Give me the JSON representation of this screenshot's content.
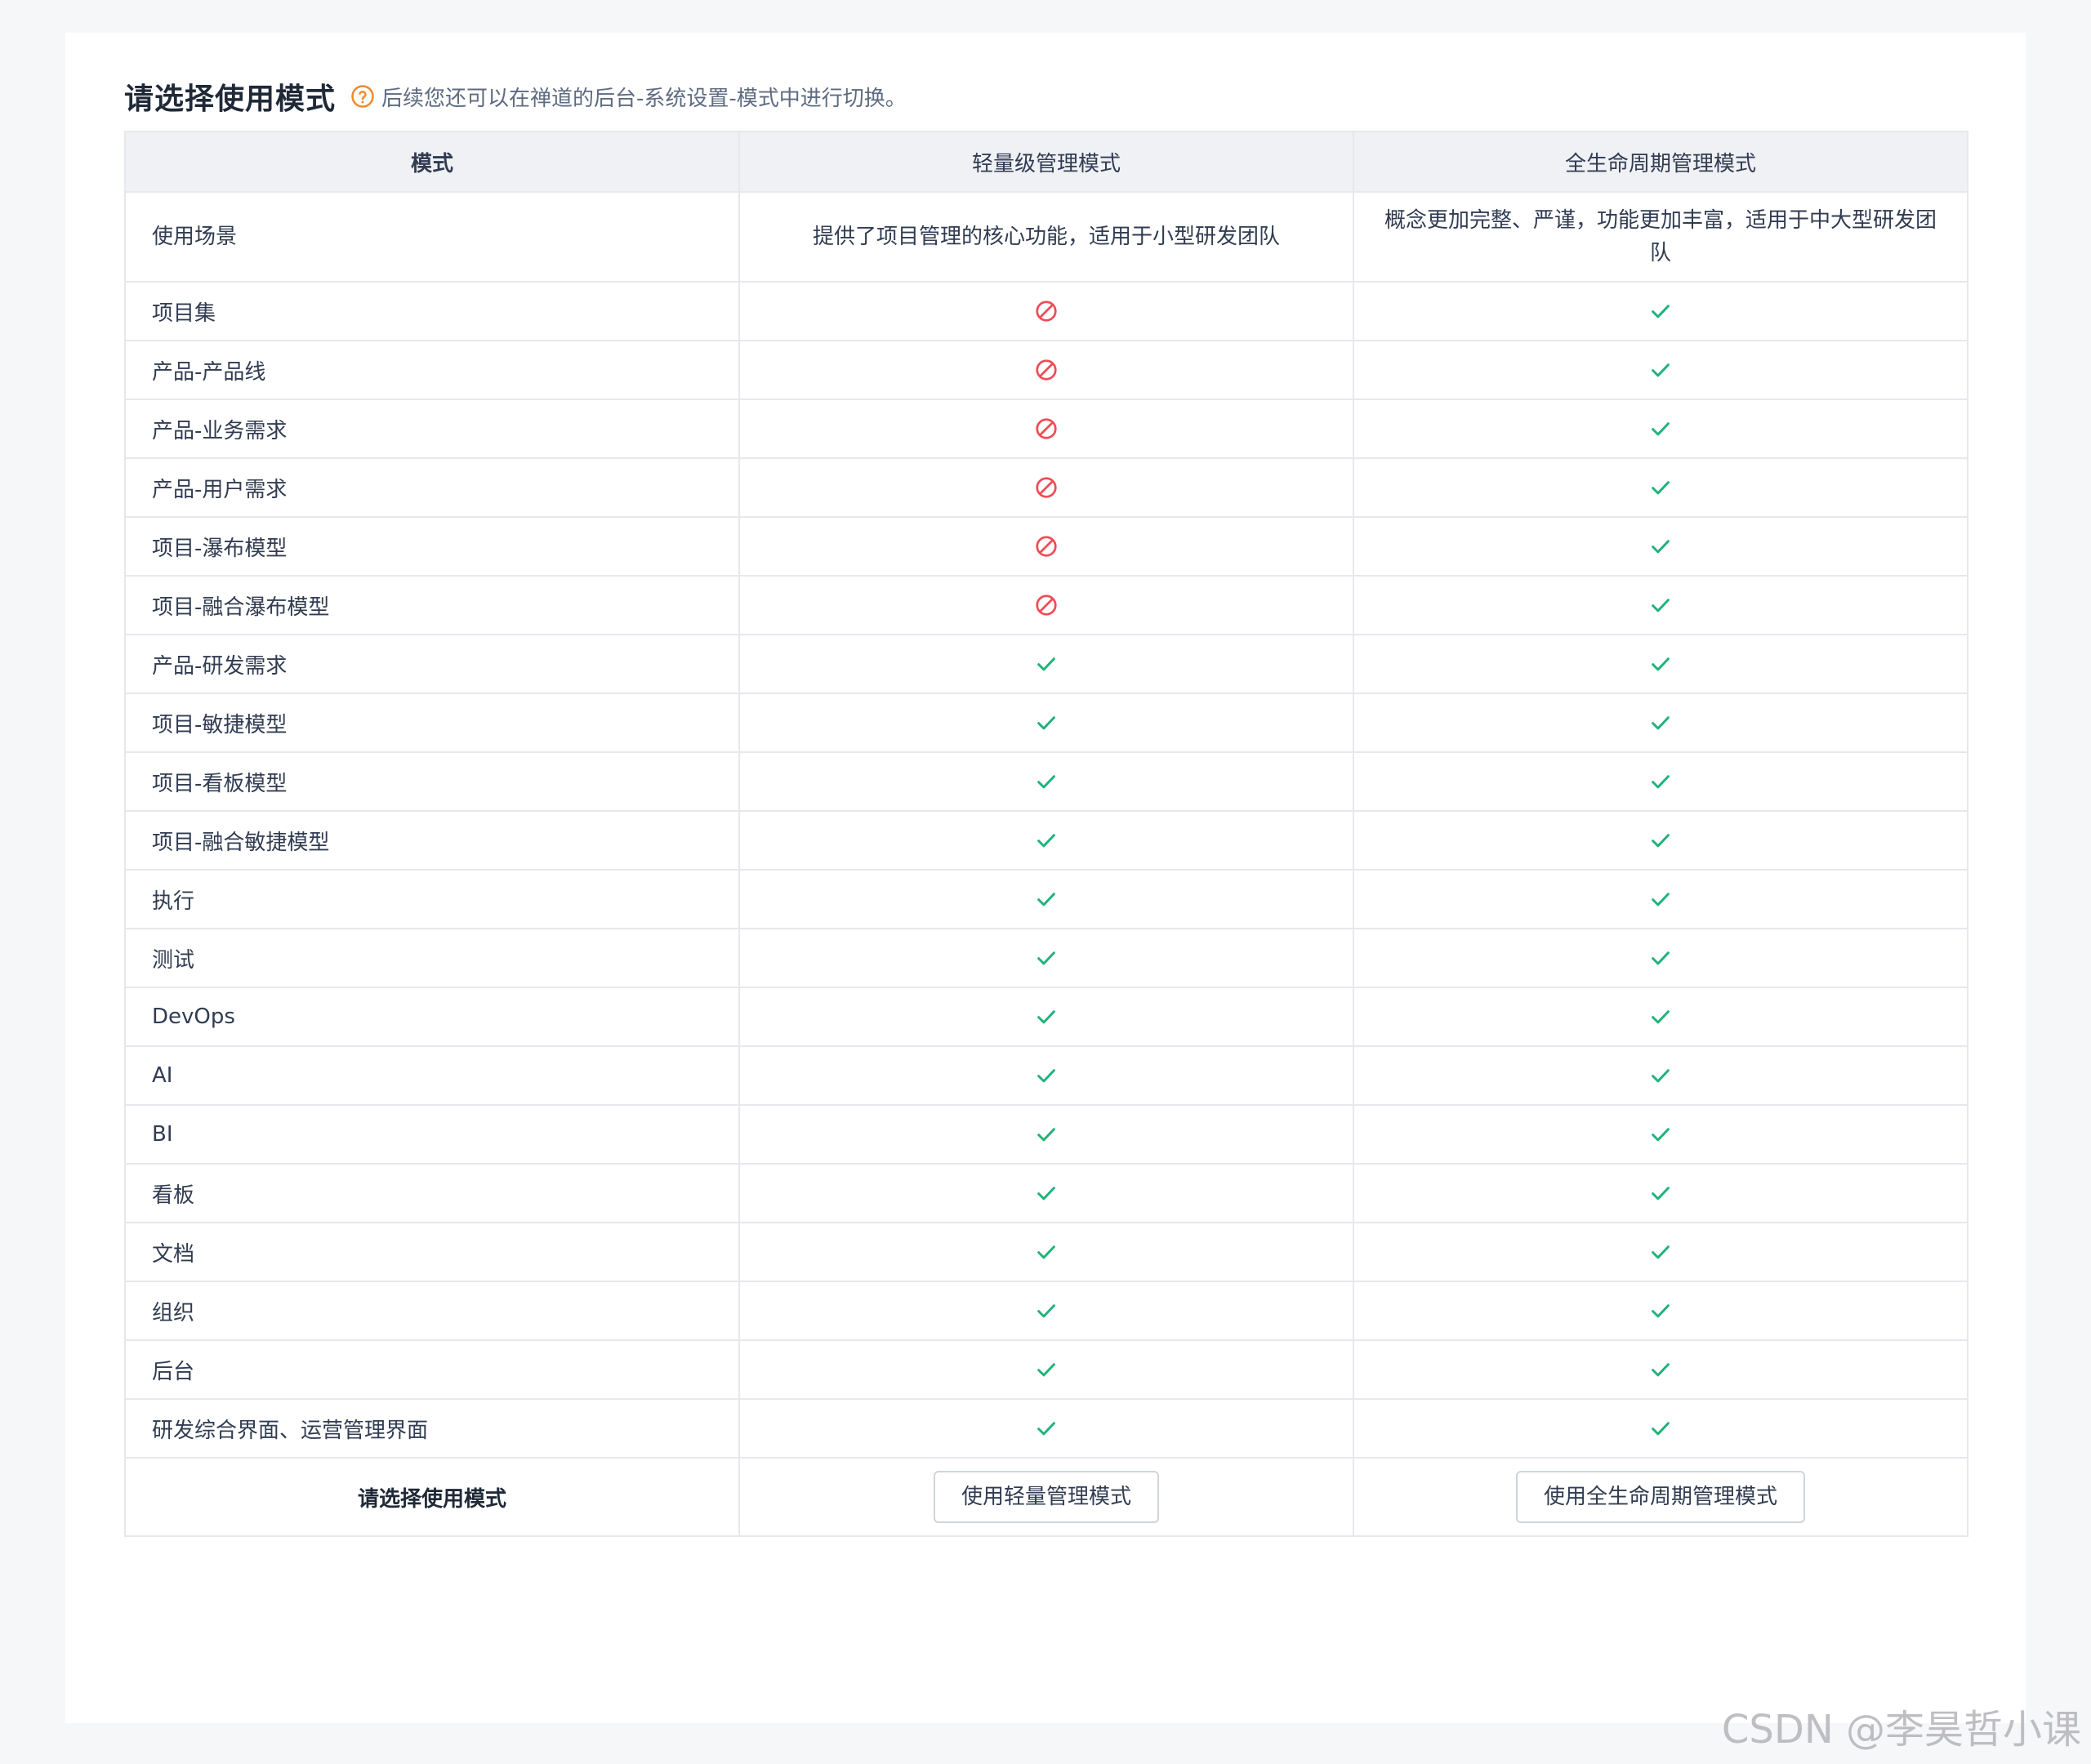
{
  "header": {
    "title": "请选择使用模式",
    "tip": "后续您还可以在禅道的后台-系统设置-模式中进行切换。"
  },
  "table": {
    "columns": [
      "模式",
      "轻量级管理模式",
      "全生命周期管理模式"
    ],
    "scenario": {
      "label": "使用场景",
      "light": "提供了项目管理的核心功能，适用于小型研发团队",
      "full": "概念更加完整、严谨，功能更加丰富，适用于中大型研发团队"
    },
    "rows": [
      {
        "label": "项目集",
        "light": "no",
        "full": "yes"
      },
      {
        "label": "产品-产品线",
        "light": "no",
        "full": "yes"
      },
      {
        "label": "产品-业务需求",
        "light": "no",
        "full": "yes"
      },
      {
        "label": "产品-用户需求",
        "light": "no",
        "full": "yes"
      },
      {
        "label": "项目-瀑布模型",
        "light": "no",
        "full": "yes"
      },
      {
        "label": "项目-融合瀑布模型",
        "light": "no",
        "full": "yes"
      },
      {
        "label": "产品-研发需求",
        "light": "yes",
        "full": "yes"
      },
      {
        "label": "项目-敏捷模型",
        "light": "yes",
        "full": "yes"
      },
      {
        "label": "项目-看板模型",
        "light": "yes",
        "full": "yes"
      },
      {
        "label": "项目-融合敏捷模型",
        "light": "yes",
        "full": "yes"
      },
      {
        "label": "执行",
        "light": "yes",
        "full": "yes"
      },
      {
        "label": "测试",
        "light": "yes",
        "full": "yes"
      },
      {
        "label": "DevOps",
        "light": "yes",
        "full": "yes"
      },
      {
        "label": "AI",
        "light": "yes",
        "full": "yes"
      },
      {
        "label": "BI",
        "light": "yes",
        "full": "yes"
      },
      {
        "label": "看板",
        "light": "yes",
        "full": "yes"
      },
      {
        "label": "文档",
        "light": "yes",
        "full": "yes"
      },
      {
        "label": "组织",
        "light": "yes",
        "full": "yes"
      },
      {
        "label": "后台",
        "light": "yes",
        "full": "yes"
      },
      {
        "label": "研发综合界面、运营管理界面",
        "light": "yes",
        "full": "yes"
      }
    ],
    "footer": {
      "label": "请选择使用模式",
      "light_button": "使用轻量管理模式",
      "full_button": "使用全生命周期管理模式"
    }
  },
  "icons": {
    "yes": "check-icon",
    "no": "forbidden-icon",
    "tip": "question-circle-icon"
  },
  "colors": {
    "check": "#1fb37a",
    "forbidden": "#ef4d56",
    "tip_icon": "#f0892e"
  },
  "watermark": "CSDN @李昊哲小课"
}
